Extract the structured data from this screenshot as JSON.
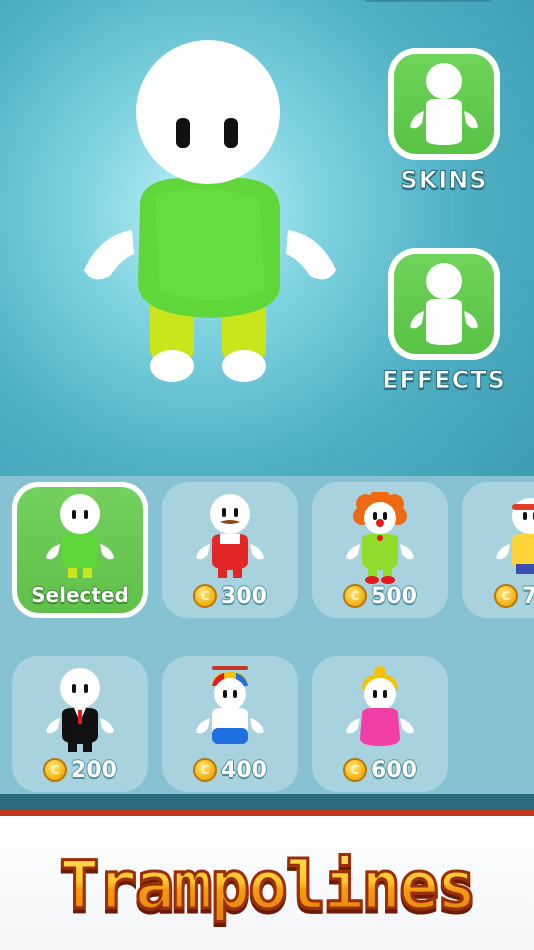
{
  "buttons": {
    "skins_label": "SKINS",
    "effects_label": "EFFECTS"
  },
  "skins": [
    {
      "status": "Selected",
      "price": null,
      "body_color": "#5fd63a"
    },
    {
      "status": "",
      "price": "300",
      "body_color": "#e32626"
    },
    {
      "status": "",
      "price": "500",
      "body_color": "#8fdc2a"
    },
    {
      "status": "",
      "price": "7",
      "body_color": "#ffd43b"
    },
    {
      "status": "",
      "price": "200",
      "body_color": "#111111"
    },
    {
      "status": "",
      "price": "400",
      "body_color": "#1f6fe0"
    },
    {
      "status": "",
      "price": "600",
      "body_color": "#f23fa8"
    }
  ],
  "coin_symbol": "C",
  "banner": {
    "title": "Trampolines"
  },
  "colors": {
    "accent_green": "#58c344",
    "coin_gold": "#f4b81c",
    "banner_orange": "#ffb51c"
  },
  "icons": [
    "skins-silhouette-icon",
    "effects-silhouette-icon",
    "coin-icon"
  ]
}
